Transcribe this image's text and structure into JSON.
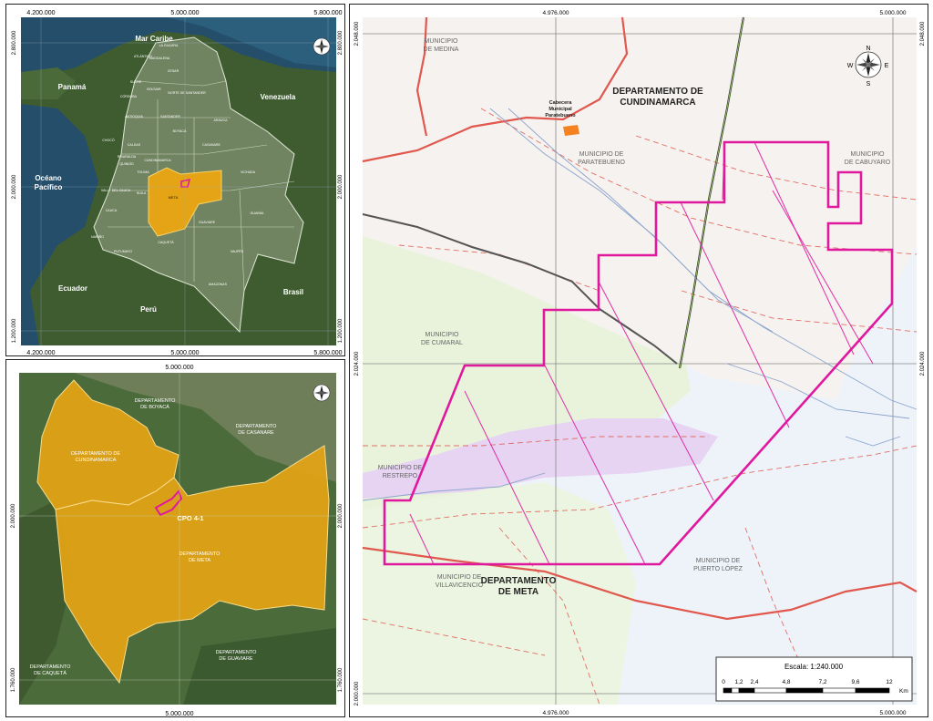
{
  "overview": {
    "top_ticks": [
      "4.200.000",
      "5.000.000",
      "5.800.000"
    ],
    "bottom_ticks": [
      "4.200.000",
      "5.000.000",
      "5.800.000"
    ],
    "left_ticks": [
      "2.800.000",
      "2.000.000",
      "1.200.000"
    ],
    "right_ticks": [
      "2.800.000",
      "2.000.000",
      "1.200.000"
    ],
    "labels": {
      "mar_caribe": "Mar Caribe",
      "panama": "Panamá",
      "venezuela": "Venezuela",
      "oceano": "Océano",
      "pacifico": "Pacífico",
      "ecuador": "Ecuador",
      "peru": "Perú",
      "brasil": "Brasil",
      "meta": "META"
    },
    "departments": [
      "LA GUAJIRA",
      "MAGDALENA",
      "ATLÁNTICO",
      "CESAR",
      "SUCRE",
      "BOLÍVAR",
      "NORTE DE SANTANDER",
      "CÓRDOBA",
      "ANTIOQUIA",
      "SANTANDER",
      "ARAUCA",
      "BOYACÁ",
      "CASANARE",
      "CALDAS",
      "CUNDINAMARCA",
      "RISARALDA",
      "QUINDÍO",
      "TOLIMA",
      "CHOCÓ",
      "VALLE DEL CAUCA",
      "HUILA",
      "VICHADA",
      "CAUCA",
      "GUAINÍA",
      "GUAVIARE",
      "NARIÑO",
      "PUTUMAYO",
      "CAQUETÁ",
      "VAUPÉS",
      "AMAZONAS"
    ]
  },
  "regional": {
    "top_tick": "5.000.000",
    "bottom_tick": "5.000.000",
    "left_ticks": [
      "2.000.000",
      "1.760.000"
    ],
    "right_ticks": [
      "2.000.000",
      "1.760.000"
    ],
    "labels": {
      "boyaca": [
        "DEPARTAMENTO",
        "DE BOYACÁ"
      ],
      "casanare": [
        "DEPARTAMENTO",
        "DE CASANARE"
      ],
      "cundinamarca": [
        "DEPARTAMENTO DE",
        "CUNDINAMARCA"
      ],
      "meta": [
        "DEPARTAMENTO",
        "DE META"
      ],
      "caqueta": [
        "DEPARTAMENTO",
        "DE CAQUETÁ"
      ],
      "guaviare": [
        "DEPARTAMENTO",
        "DE GUAVIARE"
      ],
      "block": "CPO 4-1"
    }
  },
  "detail": {
    "top_ticks": [
      "4.976.000",
      "5.000.000"
    ],
    "bottom_ticks": [
      "4.976.000",
      "5.000.000"
    ],
    "left_ticks": [
      "2.048.000",
      "2.024.000",
      "2.000.000"
    ],
    "right_ticks": [
      "2.048.000",
      "2.024.000"
    ],
    "labels": {
      "medina": [
        "MUNICIPIO",
        "DE MEDINA"
      ],
      "cabecera": [
        "Cabecera",
        "Municipal",
        "Paratebueno"
      ],
      "cundinamarca": [
        "DEPARTAMENTO DE",
        "CUNDINAMARCA"
      ],
      "cabuyaro": [
        "MUNICIPIO",
        "DE CABUYARO"
      ],
      "paratebueno": [
        "MUNICIPIO DE",
        "PARATEBUENO"
      ],
      "cumaral": [
        "MUNICIPIO",
        "DE CUMARAL"
      ],
      "restrepo": [
        "MUNICIPIO DE",
        "RESTREPO"
      ],
      "villavicencio": [
        "MUNICIPIO DE",
        "VILLAVICENCIO"
      ],
      "dept_meta": [
        "DEPARTAMENTO",
        "DE META"
      ],
      "puerto_lopez": [
        "MUNICIPIO DE",
        "PUERTO LÓPEZ"
      ]
    },
    "compass": {
      "n": "N",
      "s": "S",
      "e": "E",
      "w": "W"
    }
  },
  "scale_bar": {
    "title": "Escala: 1:240.000",
    "ticks": [
      "0",
      "1,2",
      "2,4",
      "4,8",
      "7,2",
      "9,6",
      "12"
    ],
    "unit": "Km"
  },
  "colors": {
    "cundinamarca": "#f6f2ef",
    "meta": "#eef3fa",
    "meta_mid": "#e9f3dc",
    "block_outline": "#e0189e",
    "roads": "#e0584e",
    "dept_highlight": "#e5a415"
  }
}
